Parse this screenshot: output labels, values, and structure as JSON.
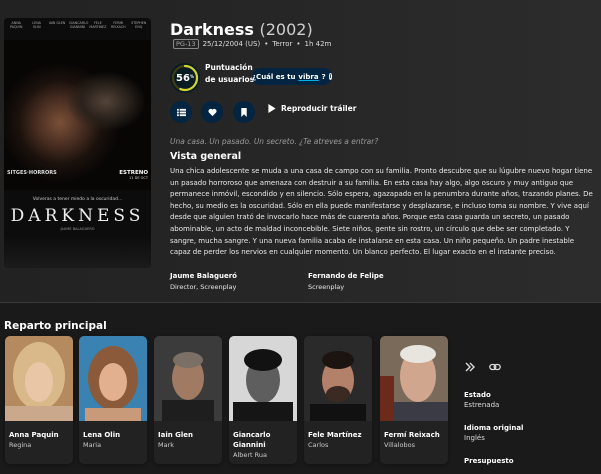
{
  "poster": {
    "credits": [
      "ANNA PAQUIN",
      "LENA OLIN",
      "IAIN GLEN",
      "GIANCARLO GIANNINI",
      "FELE MARTINEZ",
      "FERMI REIXACH",
      "STEPHEN ENQ"
    ],
    "studio": "SITGES·HORRORS",
    "release": "ESTRENO",
    "release_date": "11 DE OCT",
    "tagline": "Volveras a tener miedo a la oscuridad...",
    "title": "DARKNESS",
    "director_line": "JAUME BALAGUERÓ"
  },
  "movie": {
    "title": "Darkness",
    "year": "(2002)",
    "certification": "PG-13",
    "release": "25/12/2004 (US)",
    "genre": "Terror",
    "runtime": "1h 42m",
    "dot": "•"
  },
  "score": {
    "value": "56",
    "unit": "%",
    "percent": 56,
    "label": "Puntuación de usuarios",
    "ring_color": "#d2d531",
    "track_color": "#423d0f"
  },
  "vibe": {
    "prefix": "¿Cuál es tu ",
    "word": "vibra",
    "suffix": "?",
    "info": "i"
  },
  "actions": {
    "list_icon": "list-icon",
    "favorite_icon": "heart-icon",
    "watchlist_icon": "bookmark-icon",
    "play_icon": "play-icon",
    "trailer_label": "Reproducir tráiler"
  },
  "tagline": "Una casa. Un pasado. Un secreto. ¿Te atreves a entrar?",
  "overview_heading": "Vista general",
  "overview_text": "Una chica adolescente se muda a una casa de campo con su familia. Pronto descubre que su lúgubre nuevo hogar tiene un pasado horroroso que amenaza con destruir a su familia. En esta casa hay algo, algo oscuro y muy antiguo que permanece inmóvil, escondido y en silencio. Sólo espera, agazapado en la penumbra durante años, trazando planes. De hecho, su medio es la oscuridad. Sólo en ella puede manifestarse y desplazarse, e incluso toma su nombre. Y vive aquí desde que alguien trató de invocarlo hace más de cuarenta años. Porque esta casa guarda un secreto, un pasado abominable, un acto de maldad inconcebible. Siete niños, gente sin rostro, un círculo que debe ser completado. Y sangre, mucha sangre. Y una nueva familia acaba de instalarse en esta casa. Un niño pequeño. Un padre inestable capaz de perder los nervios en cualquier momento. Un blanco perfecto. El lugar exacto en el instante preciso.",
  "crew": [
    {
      "name": "Jaume Balagueró",
      "job": "Director, Screenplay"
    },
    {
      "name": "Fernando de Felipe",
      "job": "Screenplay"
    }
  ],
  "cast_heading": "Reparto principal",
  "cast": [
    {
      "name": "Anna Paquin",
      "role": "Regina"
    },
    {
      "name": "Lena Olin",
      "role": "Maria"
    },
    {
      "name": "Iain Glen",
      "role": "Mark"
    },
    {
      "name": "Giancarlo Giannini",
      "role": "Albert Rua"
    },
    {
      "name": "Fele Martínez",
      "role": "Carlos"
    },
    {
      "name": "Fermí Reixach",
      "role": "Villalobos"
    }
  ],
  "side": {
    "status_label": "Estado",
    "status_value": "Estrenada",
    "language_label": "Idioma original",
    "language_value": "Inglés",
    "budget_label": "Presupuesto"
  }
}
